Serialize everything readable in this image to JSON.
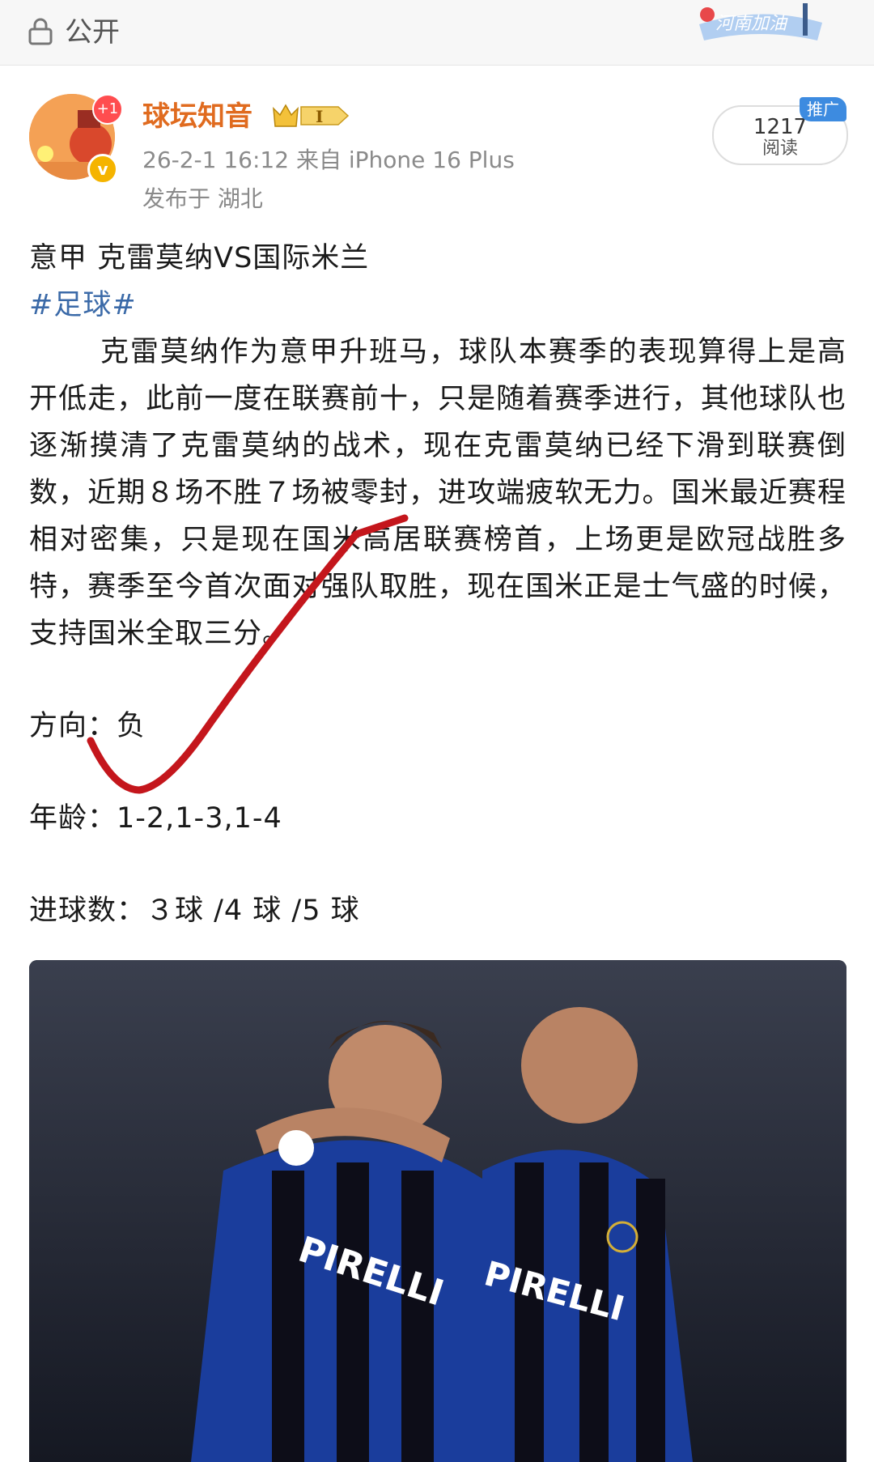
{
  "topbar": {
    "visibility_label": "公开",
    "lock_icon": "lock-icon",
    "badge_text": "河南加油"
  },
  "author": {
    "name": "球坛知音",
    "level_badge": "I",
    "avatar_notification": "+1",
    "verified_icon": "v-verified-icon"
  },
  "post_meta": {
    "time_source": "26-2-1 16:12  来自 iPhone 16 Plus",
    "location": "发布于 湖北"
  },
  "stats": {
    "reads_count": "1217",
    "reads_label": "阅读",
    "promo_label": "推广"
  },
  "content": {
    "title": "意甲 克雷莫纳VS国际米兰",
    "hashtag": "#足球#",
    "paragraph": "克雷莫纳作为意甲升班马，球队本赛季的表现算得上是高开低走，此前一度在联赛前十，只是随着赛季进行，其他球队也逐渐摸清了克雷莫纳的战术，现在克雷莫纳已经下滑到联赛倒数，近期８场不胜７场被零封，进攻端疲软无力。国米最近赛程相对密集，只是现在国米高居联赛榜首，上场更是欧冠战胜多特，赛季至今首次面对强队取胜，现在国米正是士气盛的时候，支持国米全取三分。",
    "direction": "方向：负",
    "age": "年龄：1-2,1-3,1-4",
    "goals": "进球数：３球 /4 球 /5 球"
  },
  "colors": {
    "username": "#e06b1f",
    "hashtag": "#3b6aa8",
    "check_mark": "#c4161c",
    "promo": "#3d8be0"
  }
}
